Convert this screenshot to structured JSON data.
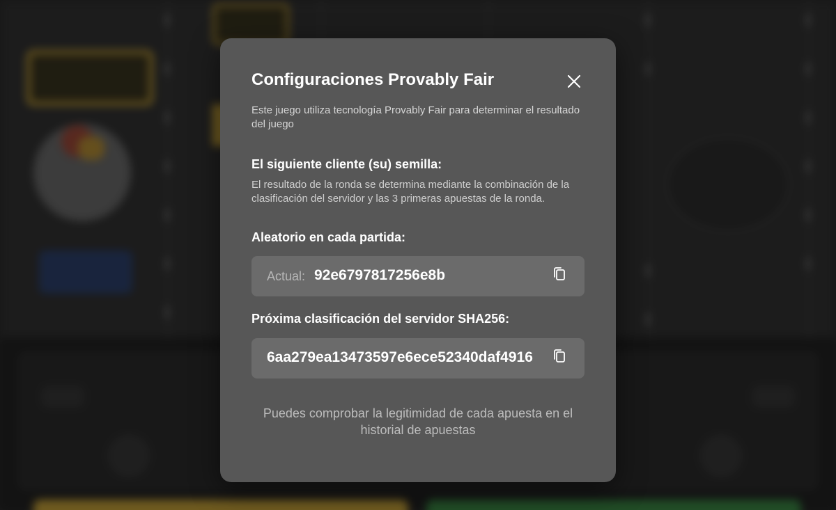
{
  "modal": {
    "title": "Configuraciones Provably Fair",
    "intro": "Este juego utiliza tecnología Provably Fair para determinar el resultado del juego",
    "client_seed": {
      "heading": "El siguiente cliente (su) semilla:",
      "description": "El resultado de la ronda se determina mediante la combinación de la clasificación del servidor y las 3 primeras apuestas de la ronda."
    },
    "random": {
      "heading": "Aleatorio en cada partida:",
      "label": "Actual:",
      "value": "92e6797817256e8b"
    },
    "server_seed": {
      "heading": "Próxima clasificación del servidor SHA256:",
      "value": "6aa279ea13473597e6ece52340daf4916"
    },
    "footer_note": "Puedes comprobar la legitimidad de cada apuesta en el historial de apuestas",
    "icons": {
      "close": "close-icon",
      "copy": "copy-icon"
    }
  },
  "colors": {
    "modal_bg": "#575757",
    "field_bg": "#6b6b6b",
    "accent_yellow": "#c9a43a",
    "accent_green": "#3c8a45"
  }
}
